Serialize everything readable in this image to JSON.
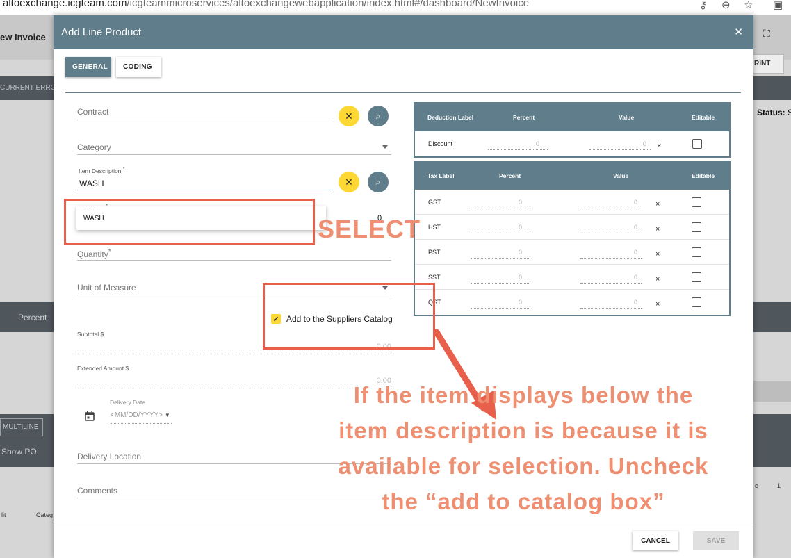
{
  "browser": {
    "url_host": "altoexchange.icgteam.com",
    "url_path": "/icgteammicroservices/altoexchangewebapplication/index.html#/dashboard/NewInvoice"
  },
  "background": {
    "title": "ew Invoice",
    "banner_text": "CURRENT ERROR",
    "print_label": "RINT",
    "status_label": "Status:",
    "status_value": "SA",
    "percent_label": "Percent",
    "multiline_label": "MULTILINE",
    "show_po_label": "Show PO",
    "col_a": "lit",
    "col_b": "Categ",
    "right_small": "e",
    "page_num": "1"
  },
  "modal": {
    "title": "Add Line Product",
    "close_icon": "close-icon",
    "tabs": [
      {
        "label": "GENERAL",
        "active": true
      },
      {
        "label": "CODING",
        "active": false
      }
    ],
    "fields": {
      "contract_label": "Contract",
      "category_label": "Category",
      "item_description_label": "Item Description",
      "item_description_value": "WASH",
      "unit_price_label": "Unit Price",
      "unit_price_value": "0",
      "autocomplete_option": "WASH",
      "quantity_label": "Quantity",
      "uom_label": "Unit of Measure",
      "add_catalog_label": "Add to the Suppliers Catalog",
      "add_catalog_checked": true,
      "subtotal_label": "Subtotal $",
      "subtotal_value": "0.00",
      "extended_label": "Extended Amount $",
      "extended_value": "0.00",
      "delivery_date_label": "Delivery Date",
      "delivery_date_placeholder": "<MM/DD/YYYY>",
      "delivery_location_label": "Delivery Location",
      "comments_label": "Comments"
    },
    "deduction_table": {
      "headers": [
        "Deduction Label",
        "Percent",
        "Value",
        "Editable"
      ],
      "rows": [
        {
          "label": "Discount",
          "percent": "0",
          "value": "0"
        }
      ]
    },
    "tax_table": {
      "headers": [
        "Tax Label",
        "Percent",
        "Value",
        "Editable"
      ],
      "rows": [
        {
          "label": "GST",
          "percent": "0",
          "value": "0"
        },
        {
          "label": "HST",
          "percent": "0",
          "value": "0"
        },
        {
          "label": "PST",
          "percent": "0",
          "value": "0"
        },
        {
          "label": "SST",
          "percent": "0",
          "value": "0"
        },
        {
          "label": "QST",
          "percent": "0",
          "value": "0"
        }
      ]
    },
    "footer": {
      "cancel_label": "CANCEL",
      "save_label": "SAVE"
    }
  },
  "annotations": {
    "select_text": "SELECT",
    "note_lines": [
      "If the item displays below the",
      "item description is because it is",
      "available for selection.  Uncheck",
      "the “add to catalog box”"
    ],
    "accent_color": "#e8604c"
  }
}
